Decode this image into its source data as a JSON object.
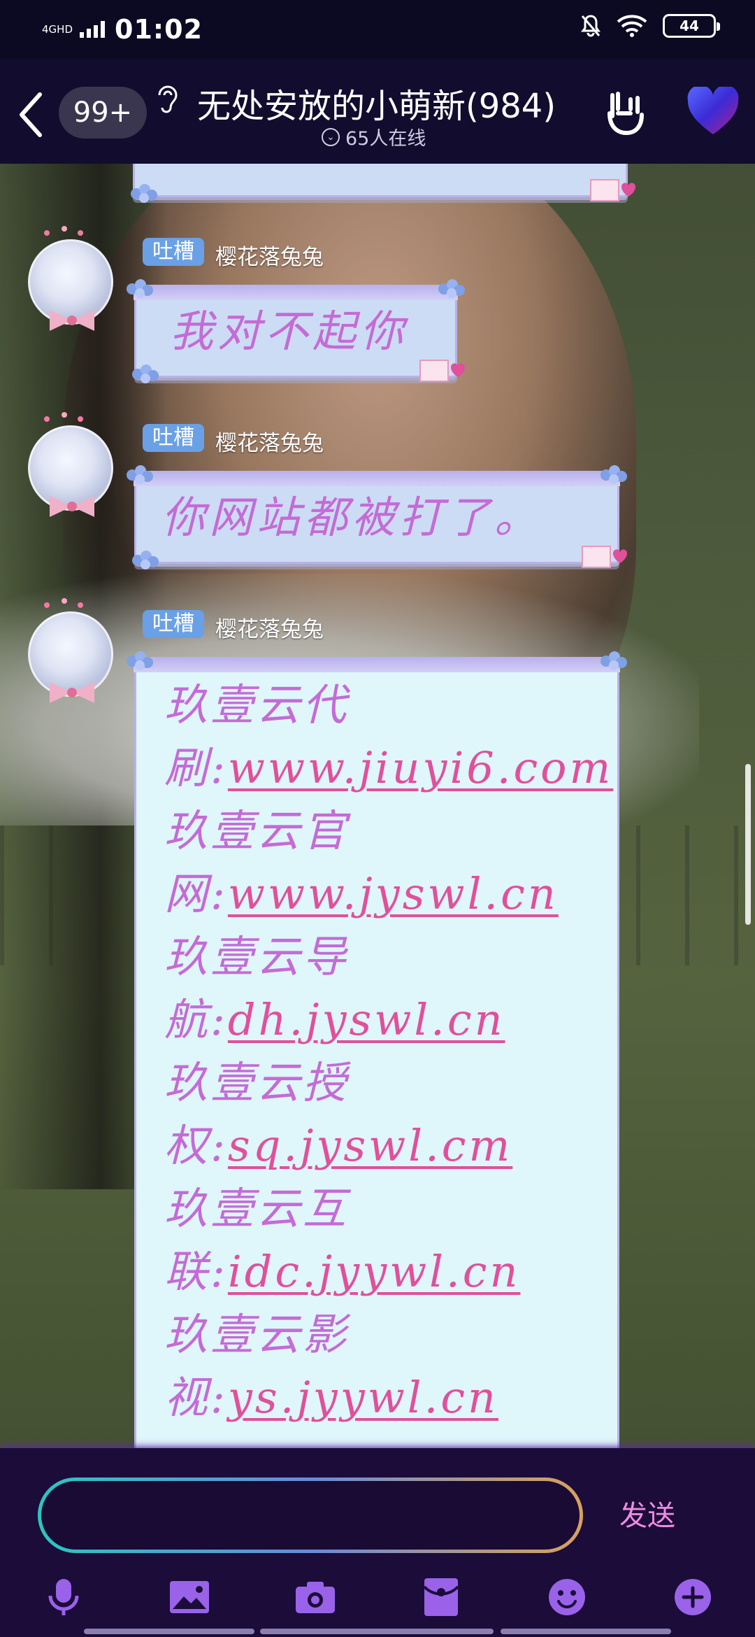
{
  "status_bar": {
    "network": "4GHD",
    "time": "01:02",
    "battery": "44"
  },
  "header": {
    "unread_count": "99+",
    "group_title": "无处安放的小萌新(984)",
    "online_count": "65人在线"
  },
  "messages": [
    {
      "tag": "吐槽",
      "sender": "樱花落兔兔",
      "text": "我对不起你"
    },
    {
      "tag": "吐槽",
      "sender": "樱花落兔兔",
      "text": "你网站都被打了。"
    },
    {
      "tag": "吐槽",
      "sender": "樱花落兔兔",
      "lines": [
        {
          "prefix": "玖壹云代",
          "label": "",
          "link": ""
        },
        {
          "prefix": "刷:",
          "label": "",
          "link": "www.jiuyi6.com"
        },
        {
          "prefix": "玖壹云官",
          "label": "",
          "link": ""
        },
        {
          "prefix": "网:",
          "label": "",
          "link": "www.jyswl.cn"
        },
        {
          "prefix": "玖壹云导",
          "label": "",
          "link": ""
        },
        {
          "prefix": "航:",
          "label": "",
          "link": "dh.jyswl.cn"
        },
        {
          "prefix": "玖壹云授",
          "label": "",
          "link": ""
        },
        {
          "prefix": "权:",
          "label": "",
          "link": "sq.jyswl.cm"
        },
        {
          "prefix": "玖壹云互",
          "label": "",
          "link": ""
        },
        {
          "prefix": "联:",
          "label": "",
          "link": "idc.jyywl.cn"
        },
        {
          "prefix": "玖壹云影",
          "label": "",
          "link": ""
        },
        {
          "prefix": "视:",
          "label": "",
          "link": "ys.jyywl.cn"
        }
      ]
    }
  ],
  "input": {
    "value": "",
    "send_label": "发送"
  },
  "toolbar": {
    "icons": [
      "microphone-icon",
      "image-icon",
      "camera-icon",
      "red-packet-icon",
      "emoji-icon",
      "plus-icon"
    ]
  },
  "colors": {
    "header_bg": "#120c2e",
    "bubble_text": "#c46bd6",
    "link": "#e0509b",
    "send": "#f08ae2",
    "tag": "#6aa0e6"
  }
}
